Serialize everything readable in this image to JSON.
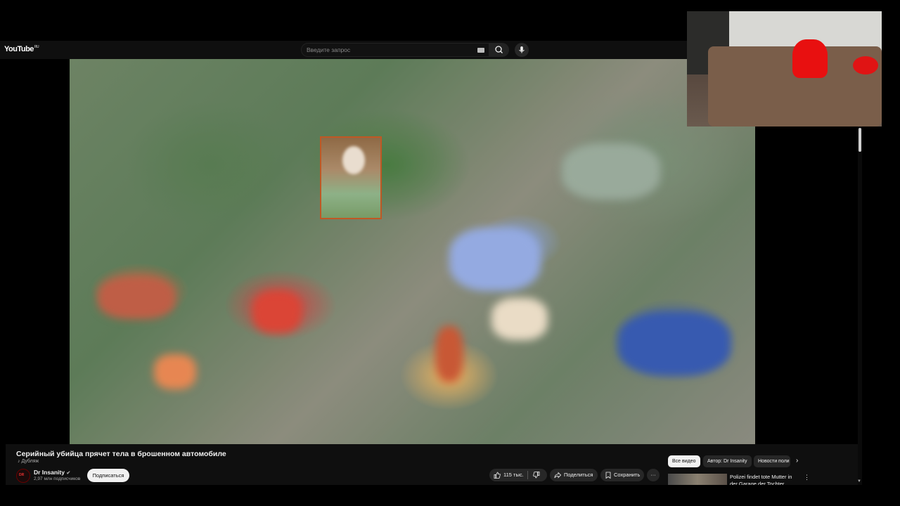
{
  "header": {
    "logo": "YouTube",
    "logo_region": "RU",
    "search_placeholder": "Введите запрос"
  },
  "video": {
    "title": "Серийный убийца прячет тела в брошенном автомобиле",
    "badge": "Дубляж"
  },
  "channel": {
    "avatar_text": "DR",
    "name": "Dr Insanity",
    "subscribers": "2,97 млн подписчиков",
    "subscribe_label": "Подписаться"
  },
  "actions": {
    "likes": "115 тыс.",
    "share_label": "Поделиться",
    "save_label": "Сохранить",
    "more_label": "···"
  },
  "filters": {
    "chips": [
      "Все видео",
      "Автор: Dr Insanity",
      "Новости поли"
    ],
    "active_index": 0
  },
  "recommendation": {
    "title": "Polizei findet tote Mutter in der Garage der Tochter"
  },
  "colors": {
    "background": "#000000",
    "surface": "#0f0f0f",
    "pill": "#272727",
    "text": "#f1f1f1",
    "pip_accent": "#e81010"
  },
  "icons": {
    "search": "search-icon",
    "mic": "mic-icon",
    "keyboard": "keyboard-icon",
    "like": "thumbs-up-icon",
    "dislike": "thumbs-down-icon",
    "share": "share-icon",
    "save": "save-icon",
    "more": "more-icon",
    "chevron": "chevron-right-icon",
    "verified": "verified-icon"
  }
}
